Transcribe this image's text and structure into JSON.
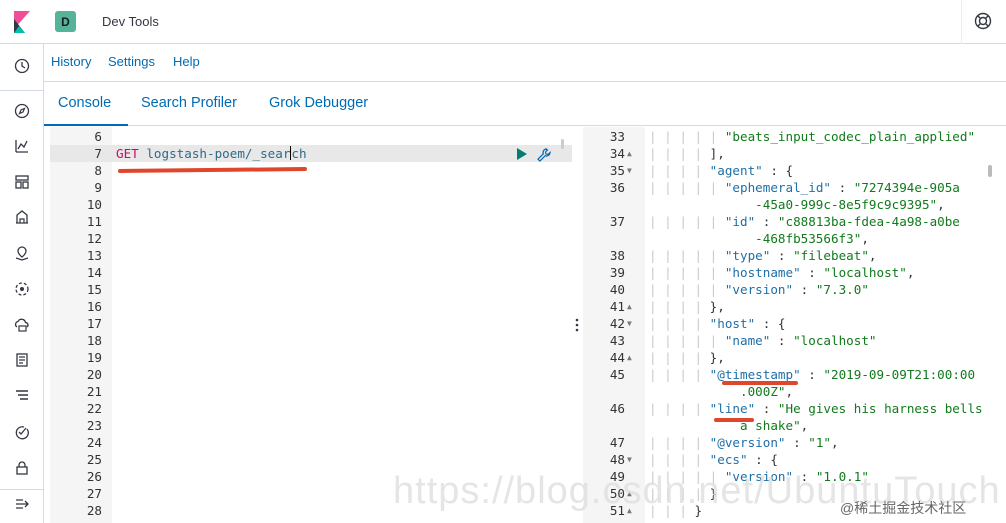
{
  "header": {
    "space_initial": "D",
    "app_title": "Dev Tools"
  },
  "subnav": {
    "links": [
      "History",
      "Settings",
      "Help"
    ]
  },
  "tabs": [
    {
      "label": "Console",
      "active": true
    },
    {
      "label": "Search Profiler",
      "active": false
    },
    {
      "label": "Grok Debugger",
      "active": false
    }
  ],
  "request_editor": {
    "method": "GET",
    "path_before_cursor": "logstash-poem/_sear",
    "path_after_cursor": "ch",
    "lines": [
      "6",
      "7",
      "8",
      "9",
      "10",
      "11",
      "12",
      "13",
      "14",
      "15",
      "16",
      "17",
      "18",
      "19",
      "20",
      "21",
      "22",
      "23",
      "24",
      "25",
      "26",
      "27",
      "28"
    ]
  },
  "response_editor": {
    "lines": [
      {
        "n": "33",
        "fold": "",
        "guides": "| | | | |",
        "parts": [
          [
            "str",
            "\"beats_input_codec_plain_applied\""
          ]
        ]
      },
      {
        "n": "34",
        "fold": "▲",
        "guides": "| | | |",
        "parts": [
          [
            "punc",
            "],"
          ]
        ]
      },
      {
        "n": "35",
        "fold": "▼",
        "guides": "| | | |",
        "parts": [
          [
            "key",
            "\"agent\""
          ],
          [
            "punc",
            " : {"
          ]
        ]
      },
      {
        "n": "36",
        "fold": "",
        "guides": "| | | | |",
        "parts": [
          [
            "key",
            "\"ephemeral_id\""
          ],
          [
            "punc",
            " : "
          ],
          [
            "str",
            "\"7274394e-905a"
          ]
        ]
      },
      {
        "n": "",
        "fold": "",
        "guides": "          ",
        "parts": [
          [
            "str",
            "   -45a0-999c-8e5f9c9c9395\""
          ],
          [
            "punc",
            ","
          ]
        ]
      },
      {
        "n": "37",
        "fold": "",
        "guides": "| | | | |",
        "parts": [
          [
            "key",
            "\"id\""
          ],
          [
            "punc",
            " : "
          ],
          [
            "str",
            "\"c88813ba-fdea-4a98-a0be"
          ]
        ]
      },
      {
        "n": "",
        "fold": "",
        "guides": "          ",
        "parts": [
          [
            "str",
            "   -468fb53566f3\""
          ],
          [
            "punc",
            ","
          ]
        ]
      },
      {
        "n": "38",
        "fold": "",
        "guides": "| | | | |",
        "parts": [
          [
            "key",
            "\"type\""
          ],
          [
            "punc",
            " : "
          ],
          [
            "str",
            "\"filebeat\""
          ],
          [
            "punc",
            ","
          ]
        ]
      },
      {
        "n": "39",
        "fold": "",
        "guides": "| | | | |",
        "parts": [
          [
            "key",
            "\"hostname\""
          ],
          [
            "punc",
            " : "
          ],
          [
            "str",
            "\"localhost\""
          ],
          [
            "punc",
            ","
          ]
        ]
      },
      {
        "n": "40",
        "fold": "",
        "guides": "| | | | |",
        "parts": [
          [
            "key",
            "\"version\""
          ],
          [
            "punc",
            " : "
          ],
          [
            "str",
            "\"7.3.0\""
          ]
        ]
      },
      {
        "n": "41",
        "fold": "▲",
        "guides": "| | | |",
        "parts": [
          [
            "punc",
            "},"
          ]
        ]
      },
      {
        "n": "42",
        "fold": "▼",
        "guides": "| | | |",
        "parts": [
          [
            "key",
            "\"host\""
          ],
          [
            "punc",
            " : {"
          ]
        ]
      },
      {
        "n": "43",
        "fold": "",
        "guides": "| | | | |",
        "parts": [
          [
            "key",
            "\"name\""
          ],
          [
            "punc",
            " : "
          ],
          [
            "str",
            "\"localhost\""
          ]
        ]
      },
      {
        "n": "44",
        "fold": "▲",
        "guides": "| | | |",
        "parts": [
          [
            "punc",
            "},"
          ]
        ]
      },
      {
        "n": "45",
        "fold": "",
        "guides": "| | | |",
        "parts": [
          [
            "key",
            "\"@timestamp\""
          ],
          [
            "punc",
            " : "
          ],
          [
            "str",
            "\"2019-09-09T21:00:00"
          ]
        ]
      },
      {
        "n": "",
        "fold": "",
        "guides": "        ",
        "parts": [
          [
            "str",
            "   .000Z\""
          ],
          [
            "punc",
            ","
          ]
        ]
      },
      {
        "n": "46",
        "fold": "",
        "guides": "| | | |",
        "parts": [
          [
            "key",
            "\"line\""
          ],
          [
            "punc",
            " : "
          ],
          [
            "str",
            "\"He gives his harness bells"
          ]
        ]
      },
      {
        "n": "",
        "fold": "",
        "guides": "        ",
        "parts": [
          [
            "str",
            "   a shake\""
          ],
          [
            "punc",
            ","
          ]
        ]
      },
      {
        "n": "47",
        "fold": "",
        "guides": "| | | |",
        "parts": [
          [
            "key",
            "\"@version\""
          ],
          [
            "punc",
            " : "
          ],
          [
            "str",
            "\"1\""
          ],
          [
            "punc",
            ","
          ]
        ]
      },
      {
        "n": "48",
        "fold": "▼",
        "guides": "| | | |",
        "parts": [
          [
            "key",
            "\"ecs\""
          ],
          [
            "punc",
            " : {"
          ]
        ]
      },
      {
        "n": "49",
        "fold": "",
        "guides": "| | | | |",
        "parts": [
          [
            "key",
            "\"version\""
          ],
          [
            "punc",
            " : "
          ],
          [
            "str",
            "\"1.0.1\""
          ]
        ]
      },
      {
        "n": "50",
        "fold": "▲",
        "guides": "| | | |",
        "parts": [
          [
            "punc",
            "}"
          ]
        ]
      },
      {
        "n": "51",
        "fold": "▲",
        "guides": "| | |",
        "parts": [
          [
            "punc",
            "}"
          ]
        ]
      }
    ]
  },
  "watermark": "https://blog.csdn.net/UbuntuTouch",
  "credit": "@稀土掘金技术社区",
  "colors": {
    "link": "#006bb4",
    "method": "#c80a68",
    "string": "#117a1c",
    "annotation": "#e0462c"
  }
}
